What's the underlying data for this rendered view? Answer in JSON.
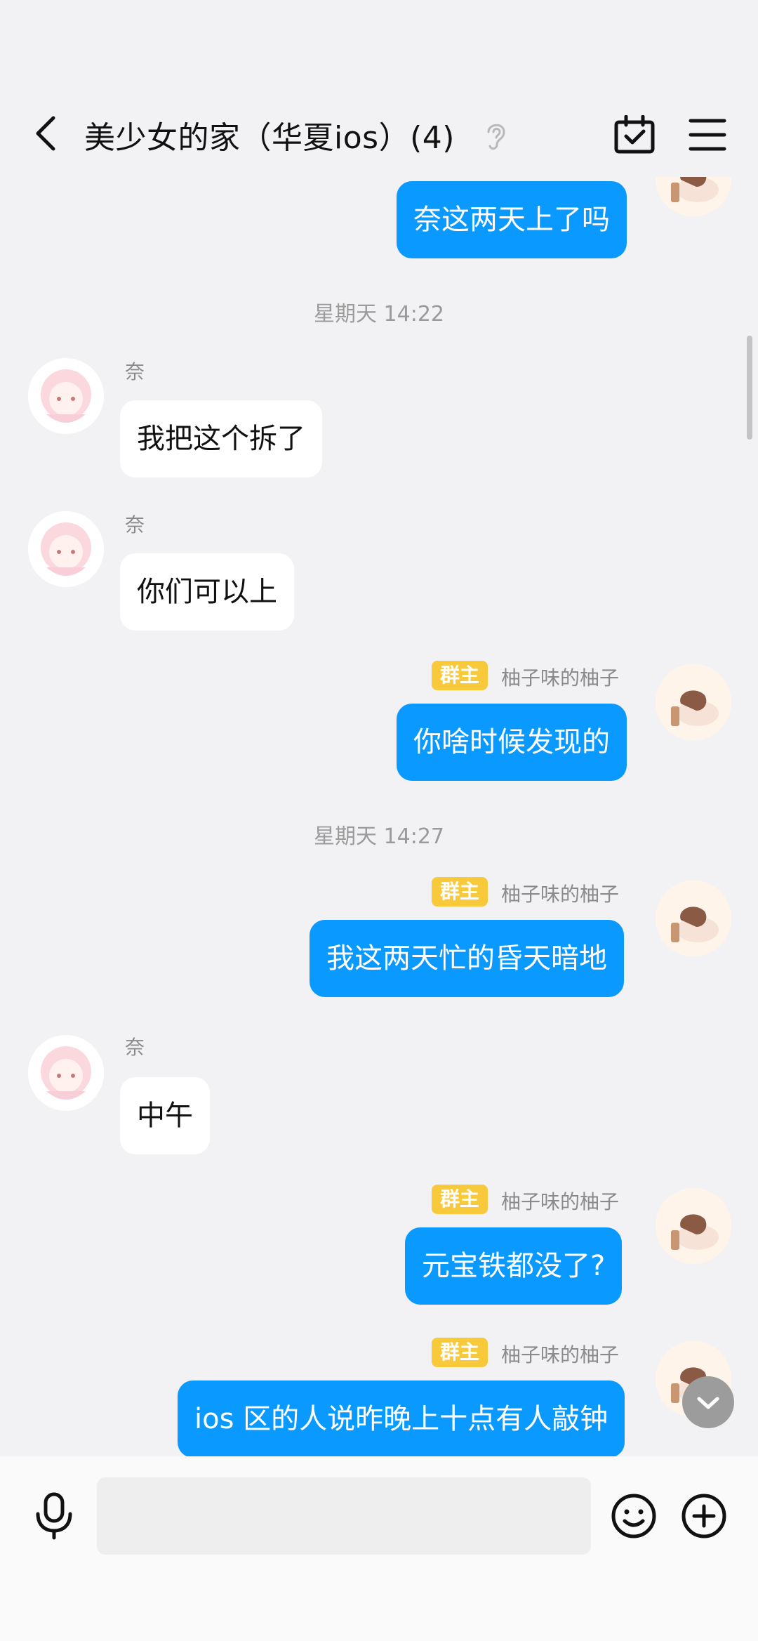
{
  "header": {
    "title": "美少女的家（华夏ios）(4)",
    "back_icon": "chevron-left-icon",
    "ear_icon": "ear-icon",
    "calendar_icon": "calendar-check-icon",
    "menu_icon": "hamburger-menu-icon"
  },
  "messages": {
    "m1_text": "奈这两天上了吗",
    "ts1": "星期天 14:22",
    "m2_sender": "奈",
    "m2_text": "我把这个拆了",
    "m3_sender": "奈",
    "m3_text": "你们可以上",
    "m4_badge": "群主",
    "m4_sender": "柚子味的柚子",
    "m4_text": "你啥时候发现的",
    "ts2": "星期天 14:27",
    "m5_badge": "群主",
    "m5_sender": "柚子味的柚子",
    "m5_text": "我这两天忙的昏天暗地",
    "m6_sender": "奈",
    "m6_text": "中午",
    "m7_badge": "群主",
    "m7_sender": "柚子味的柚子",
    "m7_text": "元宝铁都没了?",
    "m8_badge": "群主",
    "m8_sender": "柚子味的柚子",
    "m8_text": "ios 区的人说昨晚上十点有人敲钟"
  },
  "input_bar": {
    "placeholder": "",
    "mic_icon": "microphone-icon",
    "emoji_icon": "emoji-icon",
    "plus_icon": "plus-circle-icon"
  },
  "colors": {
    "outgoing_bubble": "#0a99ff",
    "incoming_bubble": "#ffffff",
    "owner_badge": "#f8c93a",
    "background": "#f2f2f4"
  }
}
